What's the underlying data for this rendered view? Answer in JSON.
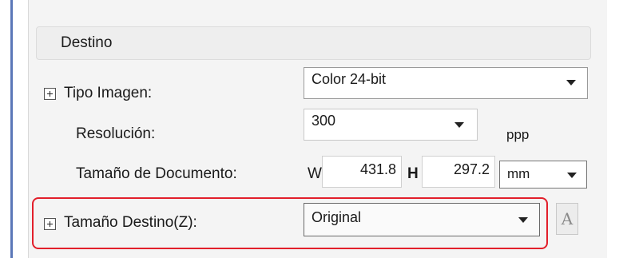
{
  "section": {
    "title": "Destino"
  },
  "tipo_imagen": {
    "label": "Tipo Imagen:",
    "value": "Color 24-bit"
  },
  "resolucion": {
    "label": "Resolución:",
    "value": "300",
    "unit": "ppp"
  },
  "tamano_documento": {
    "label": "Tamaño de Documento:",
    "w_label": "W",
    "w_value": "431.8",
    "h_label": "H",
    "h_value": "297.2",
    "unit": "mm"
  },
  "tamano_destino": {
    "label": "Tamaño Destino(Z):",
    "value": "Original",
    "font_button": "A"
  },
  "colors": {
    "highlight": "#e21f2b",
    "frame": "#5b78b8"
  }
}
